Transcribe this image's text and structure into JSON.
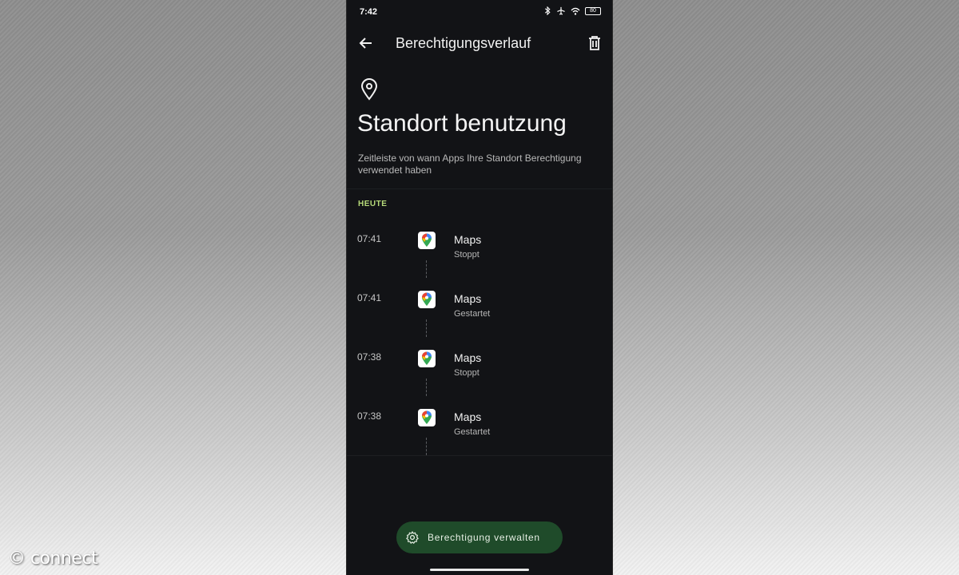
{
  "watermark": "© connect",
  "status_bar": {
    "time": "7:42",
    "battery": "80"
  },
  "app_bar": {
    "title": "Berechtigungsverlauf"
  },
  "header": {
    "title": "Standort benutzung",
    "description": "Zeitleiste von wann Apps Ihre Standort Berechtigung verwendet haben"
  },
  "section": {
    "label": "HEUTE"
  },
  "timeline": [
    {
      "time": "07:41",
      "app": "Maps",
      "state": "Stoppt"
    },
    {
      "time": "07:41",
      "app": "Maps",
      "state": "Gestartet"
    },
    {
      "time": "07:38",
      "app": "Maps",
      "state": "Stoppt"
    },
    {
      "time": "07:38",
      "app": "Maps",
      "state": "Gestartet"
    }
  ],
  "fab": {
    "label": "Berechtigung verwalten"
  },
  "colors": {
    "accent_green": "#b7db7a",
    "fab_bg": "#1f4b2a",
    "screen_bg": "#121316"
  }
}
